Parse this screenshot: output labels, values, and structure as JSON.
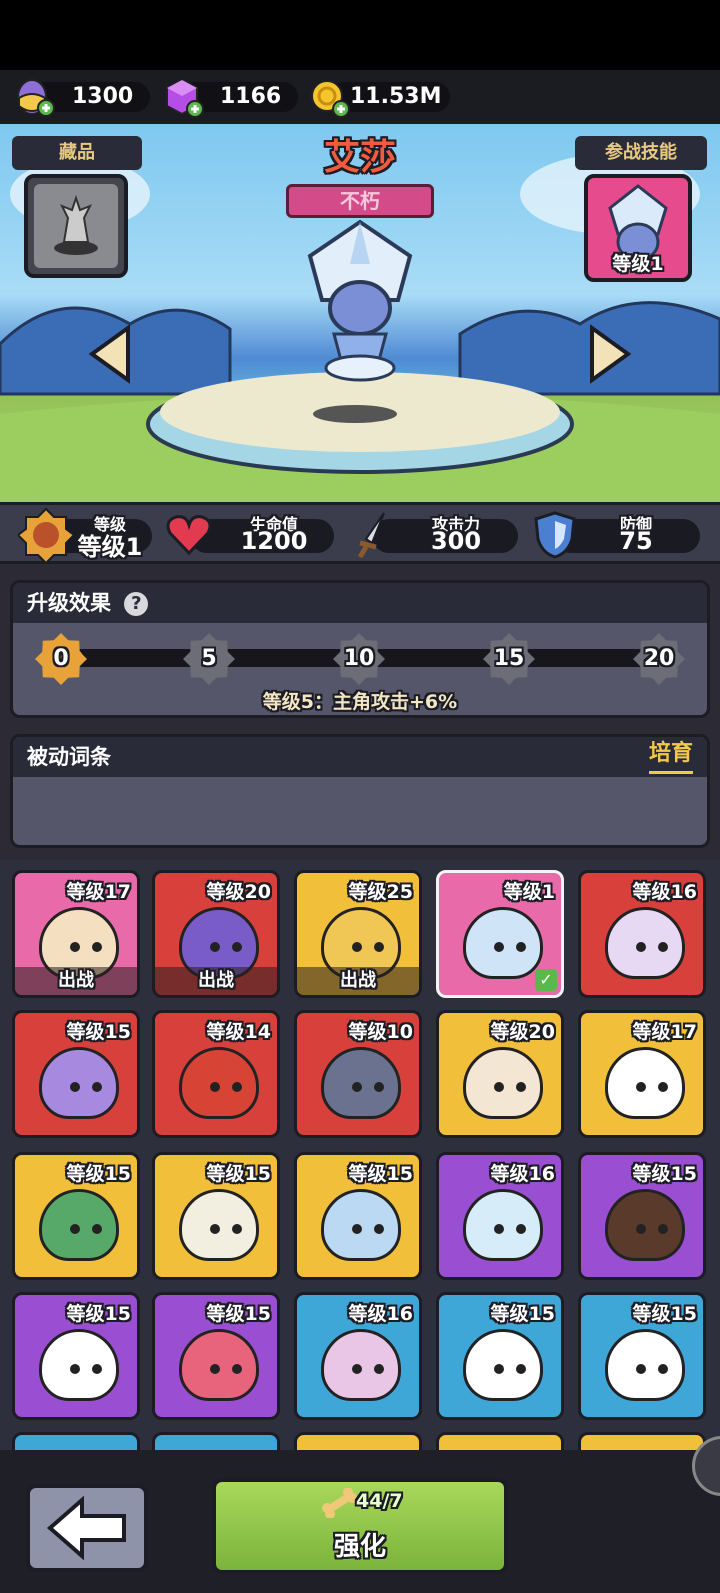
{
  "currency": {
    "eggs": "1300",
    "gems": "1166",
    "gold": "11.53M"
  },
  "hero": {
    "name": "艾莎",
    "rarity": "不朽"
  },
  "panels": {
    "collection": "藏品",
    "battle_skill": "参战技能",
    "skill_level": "等级1"
  },
  "stats": {
    "level_label": "等级",
    "level_value": "等级1",
    "hp_label": "生命值",
    "hp_value": "1200",
    "atk_label": "攻击力",
    "atk_value": "300",
    "def_label": "防御",
    "def_value": "75"
  },
  "upgrade": {
    "title": "升级效果",
    "milestones": [
      "0",
      "5",
      "10",
      "15",
      "20"
    ],
    "description": "等级5：主角攻击+6%"
  },
  "passive": {
    "title": "被动词条",
    "cultivate": "培育"
  },
  "pets": [
    {
      "level": "等级17",
      "tag": "出战",
      "bg": "#e86aa8",
      "body": "#f4e0c0"
    },
    {
      "level": "等级20",
      "tag": "出战",
      "bg": "#d8403c",
      "body": "#7a5cc8"
    },
    {
      "level": "等级25",
      "tag": "出战",
      "bg": "#f2bf3a",
      "body": "#f0c654"
    },
    {
      "level": "等级1",
      "tag": "",
      "bg": "#e86aa8",
      "body": "#cfe4f7"
    },
    {
      "level": "等级16",
      "tag": "",
      "bg": "#d8403c",
      "body": "#e7d9f4"
    },
    {
      "level": "等级15",
      "tag": "",
      "bg": "#d8403c",
      "body": "#a78ae0"
    },
    {
      "level": "等级14",
      "tag": "",
      "bg": "#d8403c",
      "body": "#d74436"
    },
    {
      "level": "等级10",
      "tag": "",
      "bg": "#d8403c",
      "body": "#6a7290"
    },
    {
      "level": "等级20",
      "tag": "",
      "bg": "#f2bf3a",
      "body": "#f3e6d2"
    },
    {
      "level": "等级17",
      "tag": "",
      "bg": "#f2bf3a",
      "body": "#ffffff"
    },
    {
      "level": "等级15",
      "tag": "",
      "bg": "#f2bf3a",
      "body": "#57a96a"
    },
    {
      "level": "等级15",
      "tag": "",
      "bg": "#f2bf3a",
      "body": "#f2eee0"
    },
    {
      "level": "等级15",
      "tag": "",
      "bg": "#f2bf3a",
      "body": "#bcd9f4"
    },
    {
      "level": "等级16",
      "tag": "",
      "bg": "#9a4ed1",
      "body": "#d6ecf8"
    },
    {
      "level": "等级15",
      "tag": "",
      "bg": "#9a4ed1",
      "body": "#5a3a2a"
    },
    {
      "level": "等级15",
      "tag": "",
      "bg": "#9a4ed1",
      "body": "#ffffff"
    },
    {
      "level": "等级15",
      "tag": "",
      "bg": "#9a4ed1",
      "body": "#e8647c"
    },
    {
      "level": "等级16",
      "tag": "",
      "bg": "#3fa6d8",
      "body": "#e9c6e6"
    },
    {
      "level": "等级15",
      "tag": "",
      "bg": "#3fa6d8",
      "body": "#ffffff"
    },
    {
      "level": "等级15",
      "tag": "",
      "bg": "#3fa6d8",
      "body": "#ffffff"
    }
  ],
  "bottom": {
    "enhance_label": "强化",
    "materials": "44/7"
  }
}
